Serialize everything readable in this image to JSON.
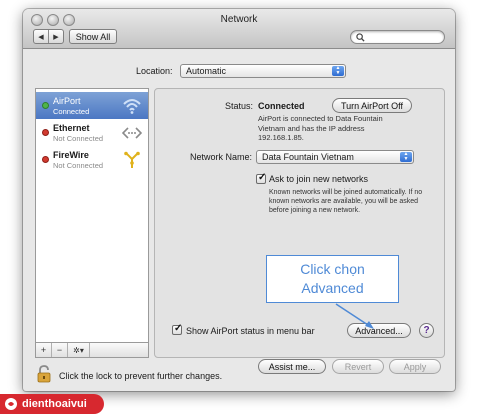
{
  "window": {
    "title": "Network"
  },
  "toolbar": {
    "back": "◀",
    "forward": "▶",
    "show_all": "Show All",
    "search_placeholder": ""
  },
  "location": {
    "label": "Location:",
    "value": "Automatic"
  },
  "services": [
    {
      "name": "AirPort",
      "status": "Connected",
      "dot_color": "#4fb548",
      "icon": "wifi-icon",
      "selected": true
    },
    {
      "name": "Ethernet",
      "status": "Not Connected",
      "dot_color": "#d23a2f",
      "icon": "ethernet-icon",
      "selected": false
    },
    {
      "name": "FireWire",
      "status": "Not Connected",
      "dot_color": "#d23a2f",
      "icon": "firewire-icon",
      "selected": false
    }
  ],
  "sidebar_tools": {
    "add": "+",
    "remove": "−",
    "gear": "✲▾"
  },
  "detail": {
    "status_label": "Status:",
    "status_value": "Connected",
    "turn_off_button": "Turn AirPort Off",
    "status_desc": "AirPort is connected to Data Fountain Vietnam and has the IP address 192.168.1.85.",
    "network_name_label": "Network Name:",
    "network_name_value": "Data Fountain Vietnam",
    "ask_join_label": "Ask to join new networks",
    "ask_join_checked": true,
    "ask_join_desc": "Known networks will be joined automatically. If no known networks are available, you will be asked before joining a new network.",
    "show_status_label": "Show AirPort status in menu bar",
    "show_status_checked": true,
    "advanced_button": "Advanced...",
    "help": "?"
  },
  "callout": {
    "line1": "Click chọn",
    "line2": "Advanced"
  },
  "footer": {
    "lock_text": "Click the lock to prevent further changes.",
    "assist_button": "Assist me...",
    "revert_button": "Revert",
    "apply_button": "Apply"
  },
  "brand": {
    "name": "dienthoaivui"
  },
  "colors": {
    "accent": "#4f8ad6",
    "selection": "#5a84c8",
    "brand_red": "#d7282f"
  }
}
